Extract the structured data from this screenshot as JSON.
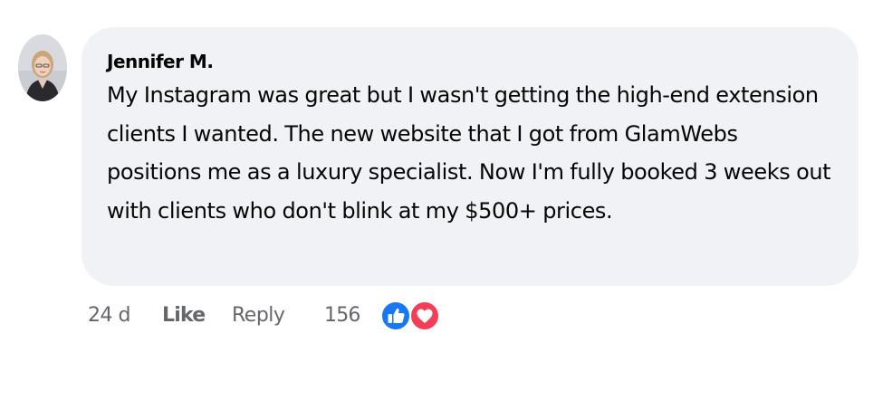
{
  "comment": {
    "author": "Jennifer M.",
    "text": "My Instagram was great but I wasn't getting the high-end extension clients I wanted. The new website that I got from GlamWebs positions me as a luxury specialist. Now I'm fully booked 3 weeks out with clients who don't blink at my $500+ prices.",
    "avatar_icon": "profile-photo",
    "bubble_color": "#f0f2f5"
  },
  "actions": {
    "timestamp": "24 d",
    "like_label": "Like",
    "reply_label": "Reply",
    "reaction_count": "156",
    "reactions": [
      {
        "icon": "like-thumb-icon",
        "color": "#1877f2"
      },
      {
        "icon": "love-heart-icon",
        "color": "#f33e58"
      }
    ]
  },
  "colors": {
    "text": "#050505",
    "secondary_text": "#65676b"
  }
}
